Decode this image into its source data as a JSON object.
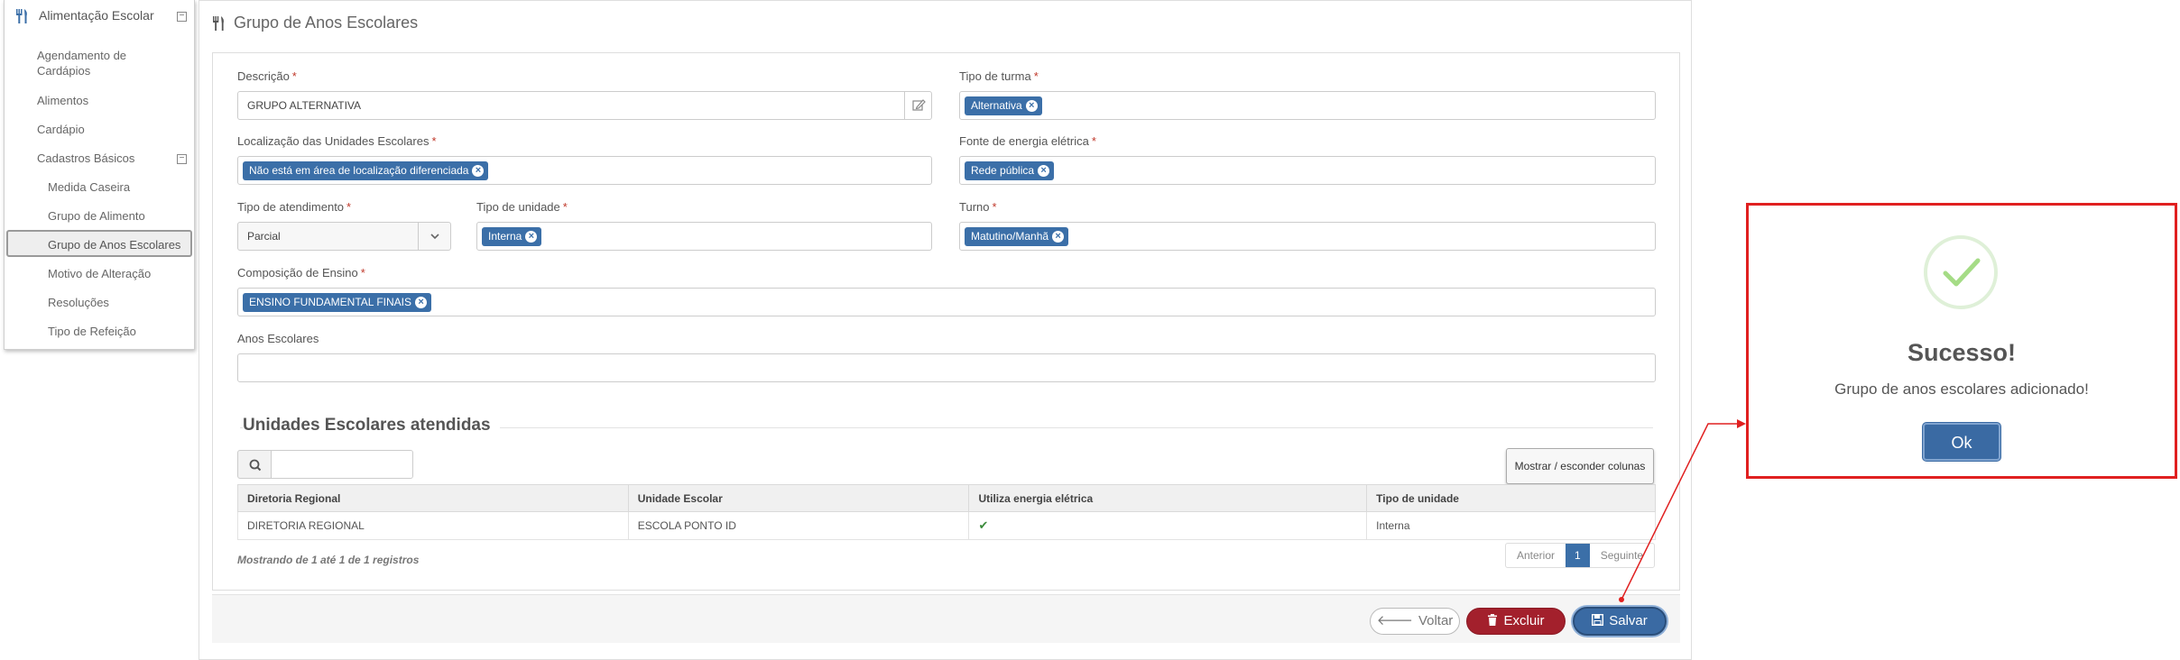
{
  "sidebar": {
    "module_title": "Alimentação Escolar",
    "items": [
      {
        "label": "Agendamento de Cardápios"
      },
      {
        "label": "Alimentos"
      },
      {
        "label": "Cardápio"
      },
      {
        "label": "Cadastros Básicos"
      },
      {
        "label": "Medida Caseira"
      },
      {
        "label": "Grupo de Alimento"
      },
      {
        "label": "Grupo de Anos Escolares"
      },
      {
        "label": "Motivo de Alteração"
      },
      {
        "label": "Resoluções"
      },
      {
        "label": "Tipo de Refeição"
      }
    ],
    "active_item": "Grupo de Anos Escolares"
  },
  "page": {
    "title": "Grupo de Anos Escolares"
  },
  "form": {
    "descricao": {
      "label": "Descrição",
      "value": "GRUPO ALTERNATIVA"
    },
    "tipo_turma": {
      "label": "Tipo de turma",
      "tags": [
        "Alternativa"
      ]
    },
    "localizacao": {
      "label": "Localização das Unidades Escolares",
      "tags": [
        "Não está em área de localização diferenciada"
      ]
    },
    "fonte_energia": {
      "label": "Fonte de energia elétrica",
      "tags": [
        "Rede pública"
      ]
    },
    "tipo_atendimento": {
      "label": "Tipo de atendimento",
      "value": "Parcial"
    },
    "tipo_unidade": {
      "label": "Tipo de unidade",
      "tags": [
        "Interna"
      ]
    },
    "turno": {
      "label": "Turno",
      "tags": [
        "Matutino/Manhã"
      ]
    },
    "composicao": {
      "label": "Composição de Ensino",
      "tags": [
        "ENSINO FUNDAMENTAL FINAIS"
      ]
    },
    "anos_escolares": {
      "label": "Anos Escolares",
      "value": ""
    },
    "required_mark": "*"
  },
  "unidades": {
    "section_title": "Unidades Escolares atendidas",
    "search_placeholder": "",
    "columns_button": "Mostrar / esconder colunas",
    "table": {
      "headers": [
        "Diretoria Regional",
        "Unidade Escolar",
        "Utiliza energia elétrica",
        "Tipo de unidade"
      ],
      "rows": [
        [
          "DIRETORIA REGIONAL",
          "ESCOLA PONTO ID",
          "✔",
          "Interna"
        ]
      ]
    },
    "info": "Mostrando de 1 até 1 de 1 registros",
    "pager": {
      "prev": "Anterior",
      "current": "1",
      "next": "Seguinte"
    }
  },
  "actions": {
    "back": "Voltar",
    "delete": "Excluir",
    "save": "Salvar"
  },
  "dialog": {
    "title": "Sucesso!",
    "message": "Grupo de anos escolares adicionado!",
    "ok": "Ok"
  },
  "colors": {
    "accent": "#3b6fa8",
    "danger": "#a3202c",
    "success": "#5cb85c",
    "highlight": "#e02020"
  }
}
